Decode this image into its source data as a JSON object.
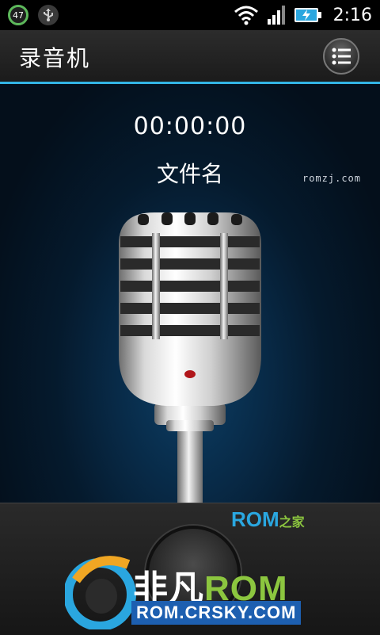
{
  "status_bar": {
    "battery_level": "47",
    "time": "2:16",
    "icons": [
      "battery-level-icon",
      "usb-icon",
      "wifi-icon",
      "signal-icon",
      "charging-battery-icon"
    ]
  },
  "action_bar": {
    "title": "录音机",
    "menu_icon": "list-menu-icon",
    "accent_color": "#33b5e5"
  },
  "watermark_small": "romzj.com",
  "recorder": {
    "timer": "00:00:00",
    "file_name": "文件名",
    "record_button_icon": "record-icon"
  },
  "watermarks": {
    "rom_logo": "ROM",
    "rom_logo_suffix": "之家",
    "brand_prefix": "非凡",
    "brand_rom": "ROM",
    "brand_url": "ROM.CRSKY.COM"
  }
}
